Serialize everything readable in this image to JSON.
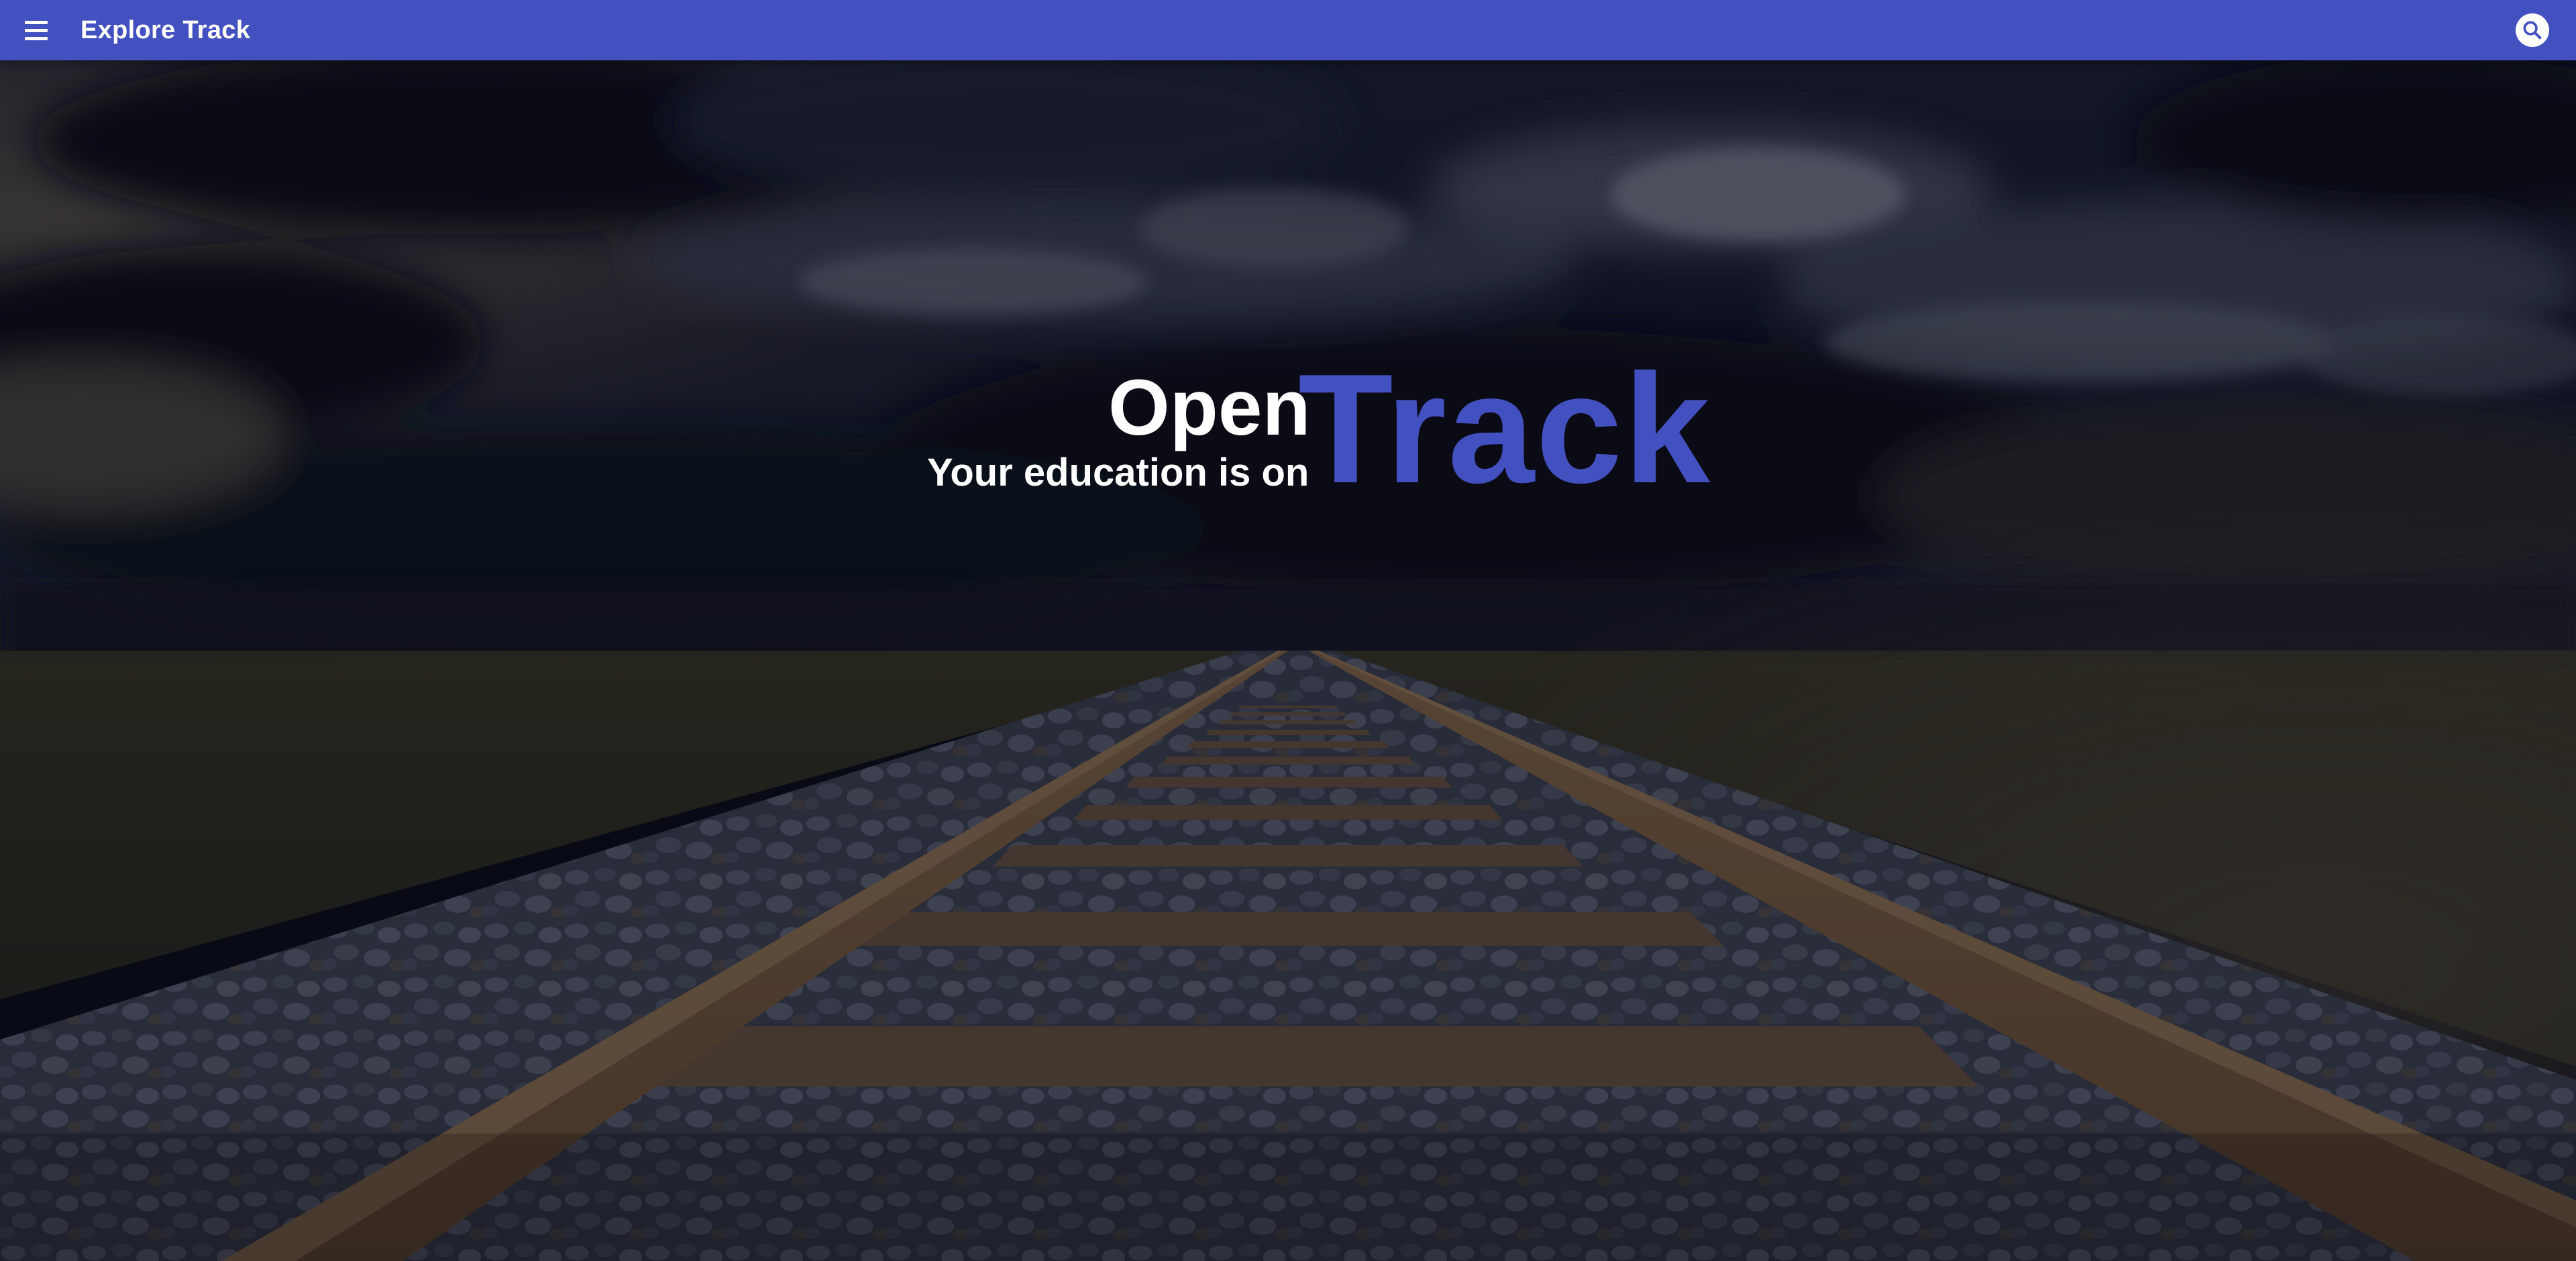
{
  "app_bar": {
    "title": "Explore Track",
    "menu_icon": "hamburger-menu-icon",
    "search_icon": "search-icon",
    "background_color": "#4350c0"
  },
  "hero": {
    "brand_word_1": "Open",
    "brand_word_2": "Track",
    "tagline": "Your education is on",
    "brand_accent_color": "#4350c0",
    "text_color": "#ffffff"
  }
}
